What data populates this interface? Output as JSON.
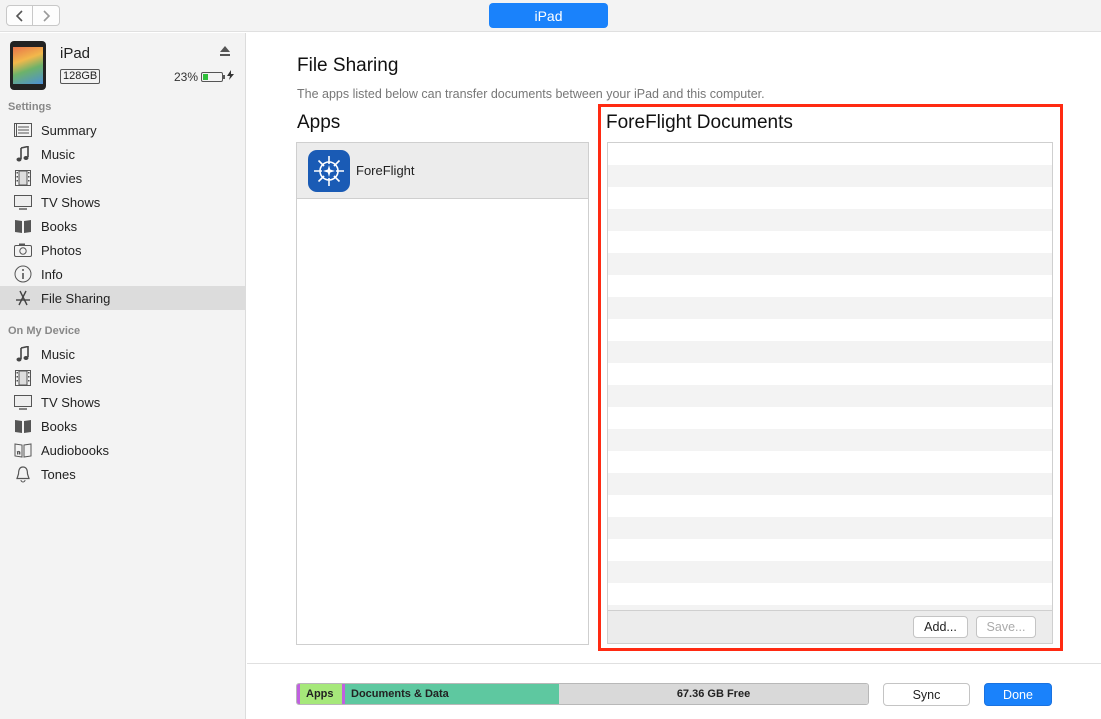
{
  "window": {
    "back_label": "‹",
    "forward_label": "›",
    "device_pill": "iPad"
  },
  "device": {
    "name": "iPad",
    "capacity": "128GB",
    "battery_text": "23%",
    "battery_level": 0.23
  },
  "sidebar": {
    "settings_label": "Settings",
    "settings_items": [
      {
        "label": "Summary",
        "icon": "list-icon"
      },
      {
        "label": "Music",
        "icon": "music-note-icon"
      },
      {
        "label": "Movies",
        "icon": "film-icon"
      },
      {
        "label": "TV Shows",
        "icon": "tv-icon"
      },
      {
        "label": "Books",
        "icon": "book-icon"
      },
      {
        "label": "Photos",
        "icon": "camera-icon"
      },
      {
        "label": "Info",
        "icon": "info-icon"
      },
      {
        "label": "File Sharing",
        "icon": "app-store-icon",
        "active": true
      }
    ],
    "device_label": "On My Device",
    "device_items": [
      {
        "label": "Music",
        "icon": "music-note-icon"
      },
      {
        "label": "Movies",
        "icon": "film-icon"
      },
      {
        "label": "TV Shows",
        "icon": "tv-icon"
      },
      {
        "label": "Books",
        "icon": "book-icon"
      },
      {
        "label": "Audiobooks",
        "icon": "audiobook-icon"
      },
      {
        "label": "Tones",
        "icon": "bell-icon"
      }
    ]
  },
  "main": {
    "title": "File Sharing",
    "description": "The apps listed below can transfer documents between your iPad and this computer.",
    "apps_title": "Apps",
    "apps": [
      {
        "name": "ForeFlight",
        "icon": "foreflight-app-icon"
      }
    ],
    "docs_title": "ForeFlight Documents",
    "add_label": "Add...",
    "save_label": "Save..."
  },
  "storage": {
    "segments": [
      {
        "label": "Apps",
        "color": "#a6e87a",
        "edge": "#c060e0"
      },
      {
        "label": "Documents & Data",
        "color": "#5ec8a0",
        "edge": "#c060e0"
      },
      {
        "label": "67.36 GB Free",
        "color": "#d9d9d9"
      }
    ]
  },
  "footer": {
    "sync_label": "Sync",
    "done_label": "Done"
  }
}
